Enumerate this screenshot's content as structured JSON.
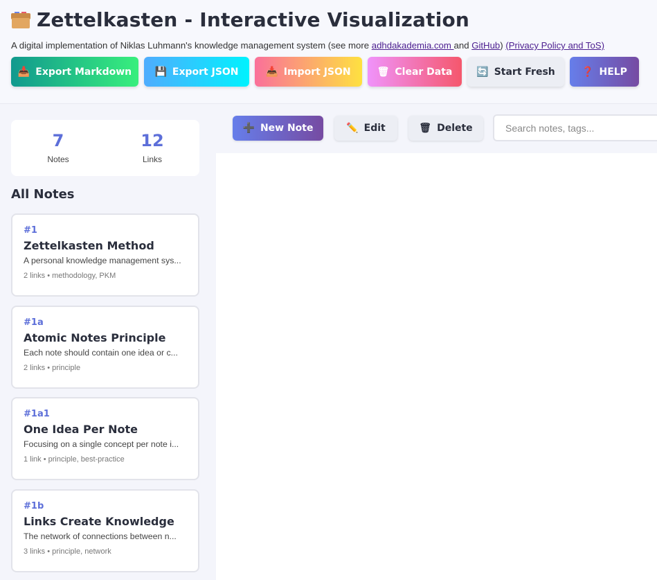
{
  "header": {
    "title": "Zettelkasten - Interactive Visualization",
    "subtitle_prefix": "A digital implementation of Niklas Luhmann's knowledge management system (see more ",
    "link_site": "adhdakademia.com ",
    "subtitle_and": "and ",
    "link_github": "GitHub",
    "subtitle_close": ") ",
    "link_privacy": "(Privacy Policy and ToS)"
  },
  "toolbar": {
    "export_markdown": "Export Markdown",
    "export_json": "Export JSON",
    "import_json": "Import JSON",
    "clear_data": "Clear Data",
    "start_fresh": "Start Fresh",
    "help": "HELP"
  },
  "stats": {
    "notes_count": "7",
    "notes_label": "Notes",
    "links_count": "12",
    "links_label": "Links"
  },
  "sidebar": {
    "section_title": "All Notes",
    "notes": [
      {
        "id": "#1",
        "title": "Zettelkasten Method",
        "excerpt": "A personal knowledge management sys...",
        "meta": "2 links • methodology, PKM"
      },
      {
        "id": "#1a",
        "title": "Atomic Notes Principle",
        "excerpt": "Each note should contain one idea or c...",
        "meta": "2 links • principle"
      },
      {
        "id": "#1a1",
        "title": "One Idea Per Note",
        "excerpt": "Focusing on a single concept per note i...",
        "meta": "1 link • principle, best-practice"
      },
      {
        "id": "#1b",
        "title": "Links Create Knowledge",
        "excerpt": "The network of connections between n...",
        "meta": "3 links • principle, network"
      }
    ]
  },
  "actions": {
    "new_note": "New Note",
    "edit": "Edit",
    "delete": "Delete",
    "search_placeholder": "Search notes, tags..."
  },
  "icons": {
    "export_markdown": "inbox-tray-icon",
    "export_json": "floppy-disk-icon",
    "import_json": "inbox-tray-icon",
    "clear_data": "wastebasket-icon",
    "start_fresh": "refresh-icon",
    "help": "question-mark-icon",
    "new_note": "plus-icon",
    "edit": "pencil-icon",
    "delete": "wastebasket-icon"
  }
}
